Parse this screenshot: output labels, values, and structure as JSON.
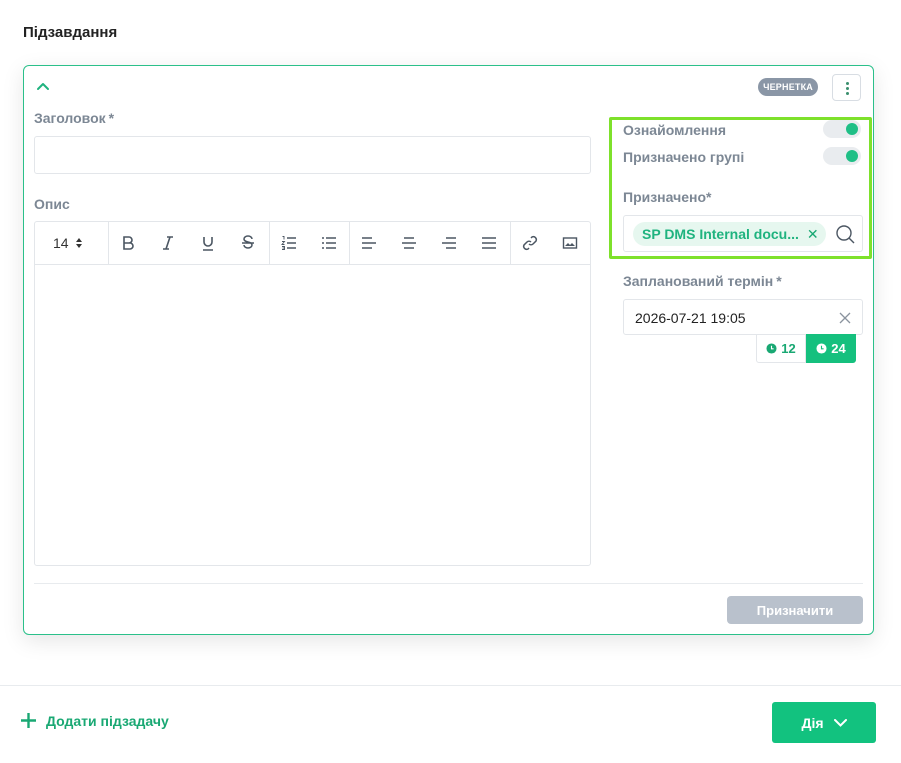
{
  "page": {
    "title": "Підзавдання"
  },
  "card": {
    "status_badge": "ЧЕРНЕТКА",
    "title_field": {
      "label": "Заголовок",
      "required_mark": "*",
      "value": ""
    },
    "description_field": {
      "label": "Опис",
      "font_size": "14",
      "toolbar_icons": [
        "bold-icon",
        "italic-icon",
        "underline-icon",
        "strikethrough-icon",
        "ordered-list-icon",
        "bullet-list-icon",
        "align-left-icon",
        "align-center-icon",
        "align-right-icon",
        "align-justify-icon",
        "link-icon",
        "image-icon"
      ]
    },
    "acknowledgement": {
      "label": "Ознайомлення",
      "enabled": true
    },
    "assigned_to_group": {
      "label": "Призначено групі",
      "enabled": true
    },
    "assigned": {
      "label": "Призначено*",
      "chip": "SP DMS Internal docu..."
    },
    "planned_deadline": {
      "label": "Запланований термін",
      "required_mark": "*",
      "value": "2026-07-21 19:05",
      "format_12": "12",
      "format_24": "24",
      "selected_format": "24"
    },
    "assign_button": "Призначити"
  },
  "footer": {
    "add_subtask": "Додати підзадачу",
    "action_button": "Дія"
  },
  "colors": {
    "accent": "#12c27f",
    "highlight": "#7ee12b",
    "badge": "#8a96a6",
    "disabled_button": "#b9c1cc"
  }
}
